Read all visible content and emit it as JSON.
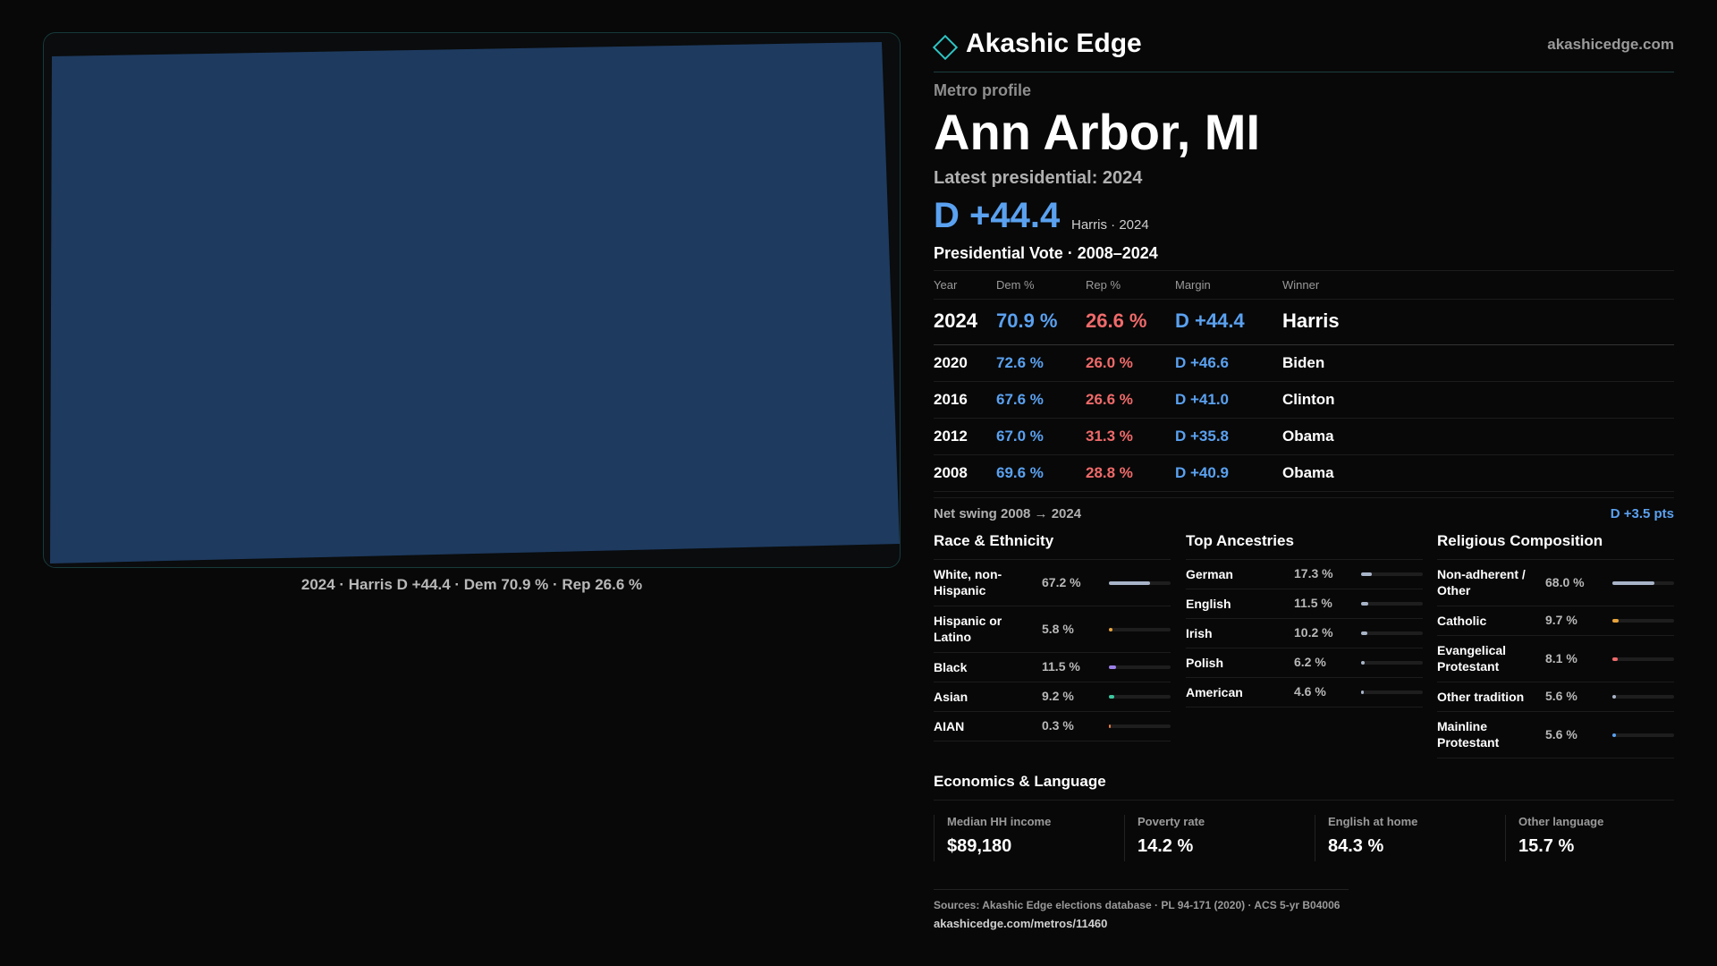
{
  "map": {
    "fill_color": "#1e3a5f",
    "caption": "2024 · Harris D +44.4 · Dem 70.9 % · Rep 26.6 %"
  },
  "brand": {
    "name": "Akashic Edge",
    "url": "akashicedge.com",
    "accent_color": "#2ec4c4"
  },
  "kicker": "Metro profile",
  "metro_name": "Ann Arbor, MI",
  "latest_label": "Latest presidential: 2024",
  "headline": {
    "margin": "D +44.4",
    "sub": "Harris · 2024"
  },
  "votes": {
    "title": "Presidential Vote · 2008–2024",
    "headers": {
      "year": "Year",
      "dem": "Dem %",
      "rep": "Rep %",
      "margin": "Margin",
      "winner": "Winner"
    },
    "rows": [
      {
        "year": "2024",
        "dem": "70.9 %",
        "rep": "26.6 %",
        "margin": "D +44.4",
        "winner": "Harris"
      },
      {
        "year": "2020",
        "dem": "72.6 %",
        "rep": "26.0 %",
        "margin": "D +46.6",
        "winner": "Biden"
      },
      {
        "year": "2016",
        "dem": "67.6 %",
        "rep": "26.6 %",
        "margin": "D +41.0",
        "winner": "Clinton"
      },
      {
        "year": "2012",
        "dem": "67.0 %",
        "rep": "31.3 %",
        "margin": "D +35.8",
        "winner": "Obama"
      },
      {
        "year": "2008",
        "dem": "69.6 %",
        "rep": "28.8 %",
        "margin": "D +40.9",
        "winner": "Obama"
      }
    ],
    "dem_color": "#5aa1f0",
    "rep_color": "#f06a6a"
  },
  "swing": {
    "label": "Net swing 2008 → 2024",
    "value": "D +3.5 pts"
  },
  "race": {
    "title": "Race & Ethnicity",
    "items": [
      {
        "label": "White, non-Hispanic",
        "pct": "67.2 %",
        "value": 67.2,
        "color": "#a8b4c8"
      },
      {
        "label": "Hispanic or Latino",
        "pct": "5.8 %",
        "value": 5.8,
        "color": "#e8a33c"
      },
      {
        "label": "Black",
        "pct": "11.5 %",
        "value": 11.5,
        "color": "#9b7fe8"
      },
      {
        "label": "Asian",
        "pct": "9.2 %",
        "value": 9.2,
        "color": "#3cc8a0"
      },
      {
        "label": "AIAN",
        "pct": "0.3 %",
        "value": 0.3,
        "color": "#e87a3c"
      }
    ]
  },
  "ancestry": {
    "title": "Top Ancestries",
    "items": [
      {
        "label": "German",
        "pct": "17.3 %",
        "value": 17.3,
        "color": "#a8b4c8"
      },
      {
        "label": "English",
        "pct": "11.5 %",
        "value": 11.5,
        "color": "#a8b4c8"
      },
      {
        "label": "Irish",
        "pct": "10.2 %",
        "value": 10.2,
        "color": "#a8b4c8"
      },
      {
        "label": "Polish",
        "pct": "6.2 %",
        "value": 6.2,
        "color": "#a8b4c8"
      },
      {
        "label": "American",
        "pct": "4.6 %",
        "value": 4.6,
        "color": "#a8b4c8"
      }
    ]
  },
  "religion": {
    "title": "Religious Composition",
    "items": [
      {
        "label": "Non-adherent / Other",
        "pct": "68.0 %",
        "value": 68.0,
        "color": "#a8b4c8"
      },
      {
        "label": "Catholic",
        "pct": "9.7 %",
        "value": 9.7,
        "color": "#e8a33c"
      },
      {
        "label": "Evangelical Protestant",
        "pct": "8.1 %",
        "value": 8.1,
        "color": "#f06a6a"
      },
      {
        "label": "Other tradition",
        "pct": "5.6 %",
        "value": 5.6,
        "color": "#a8b4c8"
      },
      {
        "label": "Mainline Protestant",
        "pct": "5.6 %",
        "value": 5.6,
        "color": "#5aa1f0"
      }
    ]
  },
  "economics": {
    "title": "Economics & Language",
    "cards": [
      {
        "label": "Median HH income",
        "value": "$89,180"
      },
      {
        "label": "Poverty rate",
        "value": "14.2 %"
      },
      {
        "label": "English at home",
        "value": "84.3 %"
      },
      {
        "label": "Other language",
        "value": "15.7 %"
      }
    ]
  },
  "sources": {
    "line1": "Sources: Akashic Edge elections database · PL 94-171 (2020) · ACS 5-yr B04006",
    "line2": "akashicedge.com/metros/11460"
  }
}
